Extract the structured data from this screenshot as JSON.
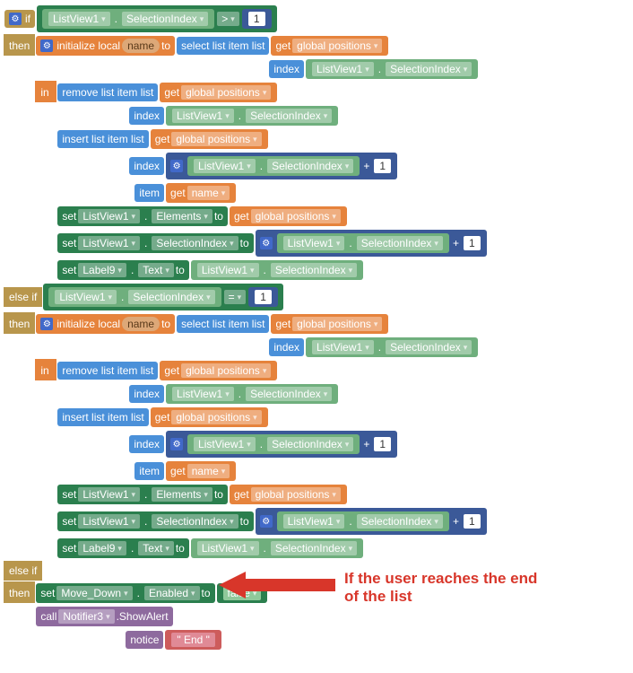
{
  "kw": {
    "if": "if",
    "then": "then",
    "elseif": "else if",
    "in": "in",
    "to": "to",
    "set": "set",
    "call": "call"
  },
  "init": {
    "label1": "initialize local",
    "label2": "to",
    "var": "name"
  },
  "sel": {
    "label": "select list item  list",
    "index": "index"
  },
  "rem": {
    "label": "remove list item  list",
    "index": "index"
  },
  "ins": {
    "label": "insert list item  list",
    "index": "index",
    "item": "item"
  },
  "get": "get",
  "comp": {
    "ListView1": "ListView1",
    "Label9": "Label9",
    "MoveDown": "Move_Down",
    "Notifier3": "Notifier3"
  },
  "prop": {
    "SelectionIndex": "SelectionIndex",
    "Elements": "Elements",
    "Text": "Text",
    "Enabled": "Enabled"
  },
  "var": {
    "globalpositions": "global positions",
    "name": "name"
  },
  "op": {
    "gt": ">",
    "eq": "=",
    "plus": "+"
  },
  "num": {
    "one": "1"
  },
  "bool": {
    "false": "false"
  },
  "method": {
    "ShowAlert": ".ShowAlert",
    "notice": "notice"
  },
  "str": {
    "end": "\"  End  \""
  },
  "annotation": "If the user reaches the end of the list"
}
